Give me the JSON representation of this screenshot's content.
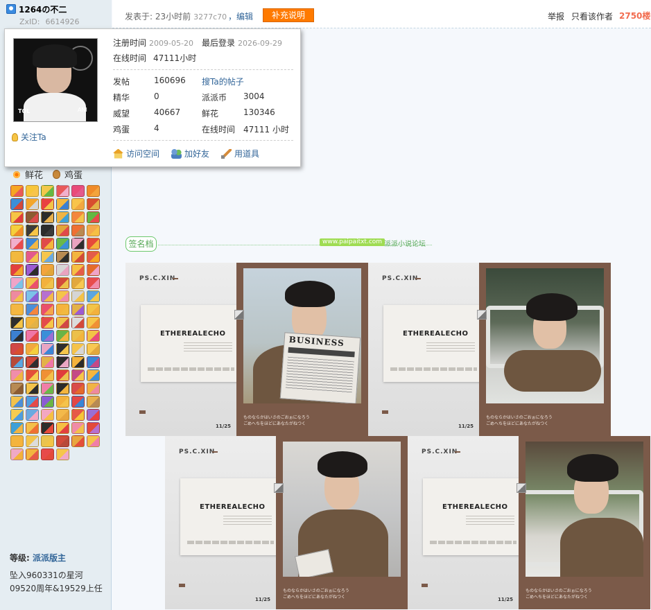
{
  "user": {
    "name": "1264の不二",
    "zxid_label": "ZxID:",
    "zxid": "6614926",
    "follow_label": "关注Ta"
  },
  "profile": {
    "reg_label": "注册时间",
    "reg_date": "2009-05-20",
    "last_login_label": "最后登录",
    "last_login": "2026-09-29",
    "online_label": "在线时间",
    "online_value": "47111小时",
    "stats": [
      {
        "label": "发帖",
        "value": "160696"
      },
      {
        "label": "精华",
        "value": "0"
      },
      {
        "label": "威望",
        "value": "40667"
      },
      {
        "label": "鸡蛋",
        "value": "4"
      }
    ],
    "stats_right": [
      {
        "label": "派派币",
        "value": "3004"
      },
      {
        "label": "鲜花",
        "value": "130346"
      },
      {
        "label": "在线时间",
        "value": "47111 小时"
      }
    ],
    "search_posts": "搜Ta的帖子",
    "actions": {
      "visit": "访问空间",
      "add_friend": "加好友",
      "use_tool": "用道具"
    }
  },
  "post": {
    "time_text": "发表于: 23小时前",
    "ip": "3277c70",
    "edit": "，编辑",
    "supplement": "补充说明",
    "report": "举报",
    "only_author": "只看该作者",
    "floor": "2750楼"
  },
  "medals": {
    "flower": "鲜花",
    "egg": "鸡蛋",
    "colors": [
      "#f6a623",
      "#f7c63a",
      "#f2c84b",
      "#e85a5a",
      "#e94b7a",
      "#f08a28",
      "#3b8fd9",
      "#f3a62c",
      "#e94141",
      "#f5b83e",
      "#f8c44b",
      "#d84e2f",
      "#f6c546",
      "#8b5c32",
      "#2c2c2c",
      "#f0b445",
      "#f4863f",
      "#63b843",
      "#f5cf3c",
      "#3b3b3b",
      "#2c2c2c",
      "#e1a63a",
      "#ef7033",
      "#f4a74b",
      "#f1b0cc",
      "#3c86d6",
      "#e04a4a",
      "#6ab84a",
      "#e9a3c0",
      "#e64a3b",
      "#f2b93f",
      "#e35a8c",
      "#f5c64c",
      "#b88a52",
      "#f3b53f",
      "#e45c4a",
      "#e24040",
      "#9c5bd2",
      "#f3a43c",
      "#d6d6d6",
      "#f6c044",
      "#e46b2b",
      "#f0a4c8",
      "#f2c04a",
      "#f3b13d",
      "#d24a3b",
      "#e2a83e",
      "#e84c4c",
      "#ed8aa0",
      "#7cc2e8",
      "#b66fd0",
      "#f4c449",
      "#d5d5d5",
      "#5aa6e0",
      "#f3b743",
      "#4c8ed8",
      "#ea4f6d",
      "#f5b33d",
      "#e3b247",
      "#f2c447",
      "#2f2f2f",
      "#f3b53d",
      "#e44a4a",
      "#f0c24b",
      "#dcdcdc",
      "#f6c648",
      "#3c80d1",
      "#ef76a7",
      "#3b8fd8",
      "#6ab446",
      "#ecc04a",
      "#f2c446",
      "#d14747",
      "#f2a840",
      "#e9a6c3",
      "#2f2f2f",
      "#f5c34a",
      "#f8c852",
      "#b74a3a",
      "#d24a3b",
      "#e3b248",
      "#2c2c2c",
      "#f4b33c",
      "#3886d6",
      "#f08dab",
      "#e44e3a",
      "#f09034",
      "#e03d3d",
      "#c44a86",
      "#f4b63e",
      "#b78a54",
      "#f3c24a",
      "#f07ea8",
      "#2c2c2c",
      "#d94b4b",
      "#f0b444",
      "#f2c24d",
      "#4f9ddf",
      "#8b5cd3",
      "#f3b13c",
      "#e24747",
      "#e9b14d",
      "#f6cc51",
      "#6aa9e0",
      "#f3a7c1",
      "#f3b94a",
      "#e65a48",
      "#9a6fd3",
      "#3ea0d8",
      "#f3c04a",
      "#2d2d2d",
      "#f5bf44",
      "#f08ba8",
      "#e34a3a",
      "#f3b43e",
      "#f3c44a",
      "#eac34f",
      "#d24b3a",
      "#e8a63e",
      "#f4c248",
      "#f0a9c6",
      "#f2b53f",
      "#e74a4a",
      "#f6c64a"
    ]
  },
  "level": {
    "label": "等级:",
    "value": "派派版主"
  },
  "bio": "坠入960331の星河　09520周年&19529上任",
  "signature": {
    "label": "签名档",
    "site": "www.paipaitxt.com",
    "forum": "派派小说论坛"
  },
  "cards": [
    {
      "brand": "PS.C.XIN",
      "title": "ETHEREALECHO",
      "jp1": "ものならかはいさのごおぉになろう",
      "jp2": "ごめへちをほどにあなたがねつく",
      "date": "11/25"
    },
    {
      "brand": "PS.C.XIN",
      "title": "ETHEREALECHO",
      "jp1": "ものならかはいさのごおぉになろう",
      "jp2": "ごめへちをほどにあなたがねつく",
      "date": "11/25"
    },
    {
      "brand": "PS.C.XIN",
      "title": "ETHEREALECHO",
      "jp1": "ものならかはいさのごおぉになろう",
      "jp2": "ごめへちをほどにあなたがねつく",
      "date": "11/25"
    },
    {
      "brand": "PS.C.XIN",
      "title": "ETHEREALECHO",
      "jp1": "ものならかはいさのごおぉになろう",
      "jp2": "ごめへちをほどにあなたがねつく",
      "date": "11/25"
    }
  ],
  "newspaper": {
    "masthead": "BUSINESS"
  },
  "avatar": {
    "text1": "TOL",
    "text2": "ANI"
  }
}
